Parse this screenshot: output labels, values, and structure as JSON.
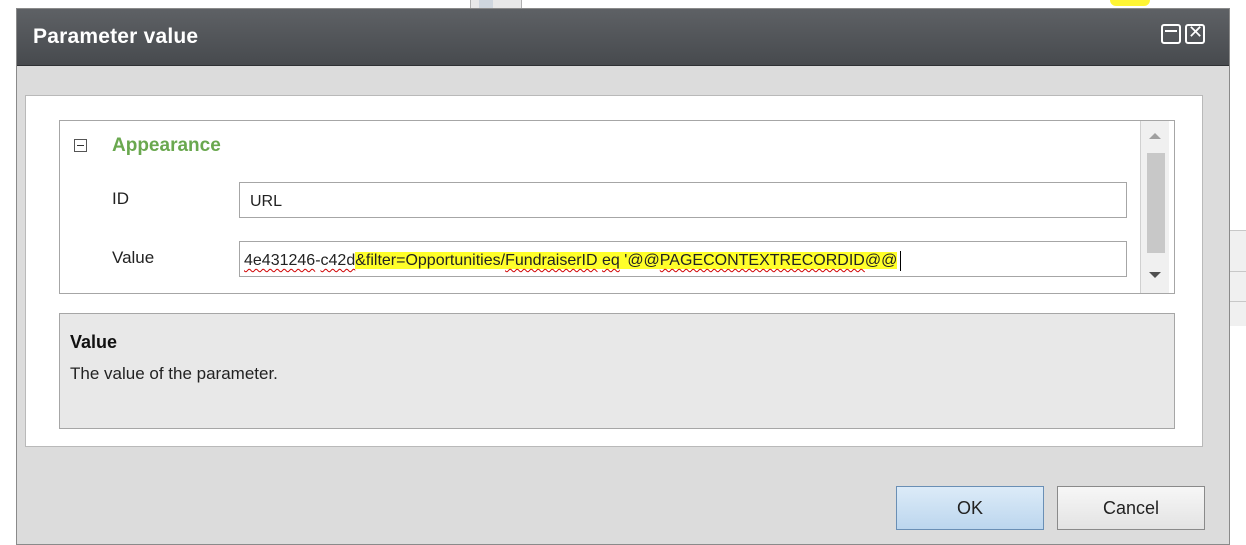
{
  "dialog": {
    "title": "Parameter value",
    "section": {
      "title": "Appearance",
      "properties": [
        {
          "label": "ID",
          "value": "URL"
        },
        {
          "label": "Value",
          "value_parts": [
            "4e431246",
            "-",
            "c42d",
            "&filter=Opportunities/",
            "FundraiserID",
            " ",
            "eq",
            " '@@",
            "PAGECONTEXTRECORDID",
            "@@"
          ]
        }
      ]
    },
    "description": {
      "title": "Value",
      "text": "The value of the parameter."
    },
    "buttons": {
      "ok": "OK",
      "cancel": "Cancel"
    }
  },
  "colors": {
    "titlebar": "#474a4e",
    "section_title": "#6aa84f",
    "highlight": "#ffff2a",
    "ok_button": "#bcd6ee"
  },
  "icons": [
    "collapse-icon",
    "maximize-icon",
    "close-icon",
    "scroll-up-icon",
    "scroll-down-icon"
  ]
}
